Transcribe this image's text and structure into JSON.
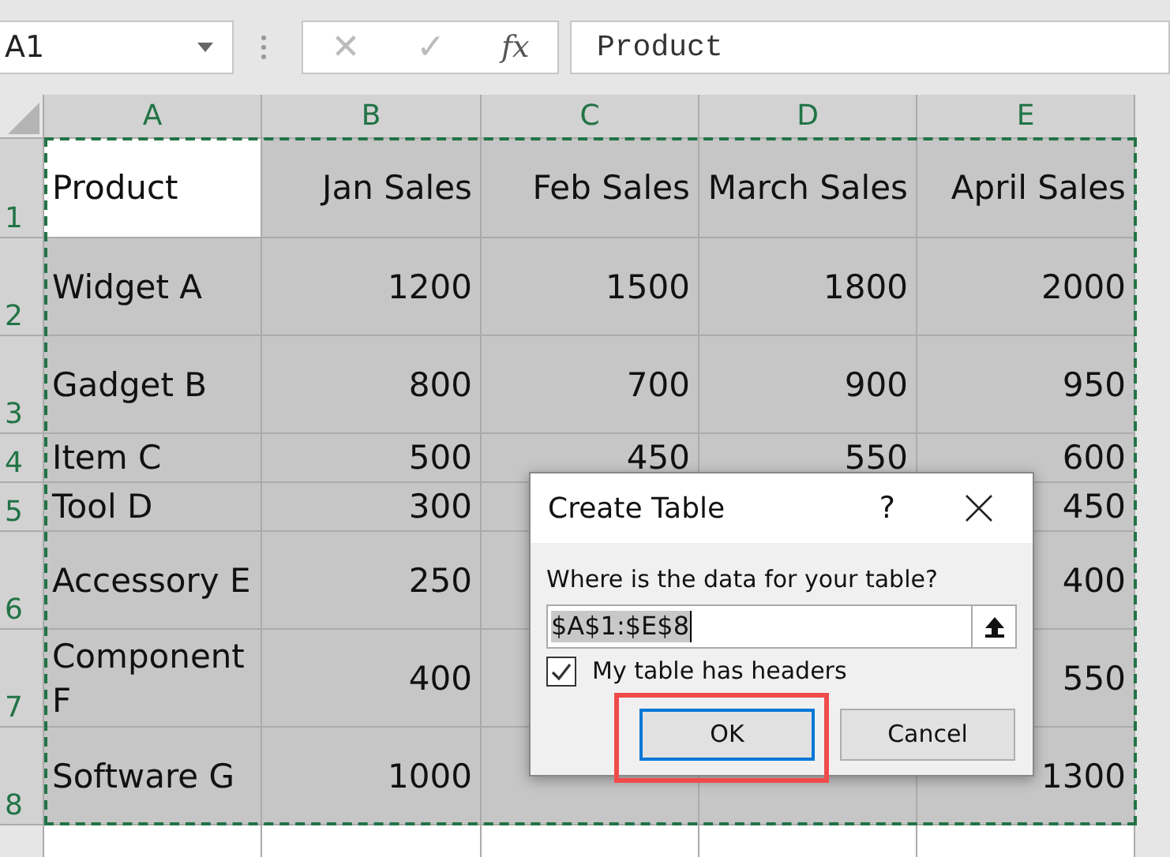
{
  "name_box": {
    "value": "A1"
  },
  "formula_bar": {
    "cancel": "✕",
    "enter": "✓",
    "function": "fx",
    "value": "Product"
  },
  "columns": [
    "A",
    "B",
    "C",
    "D",
    "E"
  ],
  "rows": [
    {
      "header": "1",
      "selected": true,
      "cells": [
        "Product",
        "Jan Sales",
        "Feb Sales",
        "March Sales",
        "April Sales"
      ]
    },
    {
      "header": "2",
      "selected": true,
      "cells": [
        "Widget A",
        "1200",
        "1500",
        "1800",
        "2000"
      ]
    },
    {
      "header": "3",
      "selected": true,
      "cells": [
        "Gadget B",
        "800",
        "700",
        "900",
        "950"
      ]
    },
    {
      "header": "4",
      "selected": true,
      "cells": [
        "Item C",
        "500",
        "450",
        "550",
        "600"
      ]
    },
    {
      "header": "5",
      "selected": true,
      "cells": [
        "Tool D",
        "300",
        null,
        null,
        "450"
      ]
    },
    {
      "header": "6",
      "selected": true,
      "cells": [
        "Accessory E",
        "250",
        null,
        null,
        "400"
      ]
    },
    {
      "header": "7",
      "selected": true,
      "cells": [
        "Component F",
        "400",
        null,
        null,
        "550"
      ]
    },
    {
      "header": "8",
      "selected": true,
      "cells": [
        "Software G",
        "1000",
        null,
        null,
        "1300"
      ]
    }
  ],
  "dialog": {
    "title": "Create Table",
    "help": "?",
    "prompt": "Where is the data for your table?",
    "range": "$A$1:$E$8",
    "headers_label": "My table has headers",
    "has_headers": true,
    "buttons": [
      {
        "label": "OK",
        "default": true,
        "highlighted": true
      },
      {
        "label": "Cancel",
        "default": false,
        "highlighted": false
      }
    ]
  }
}
